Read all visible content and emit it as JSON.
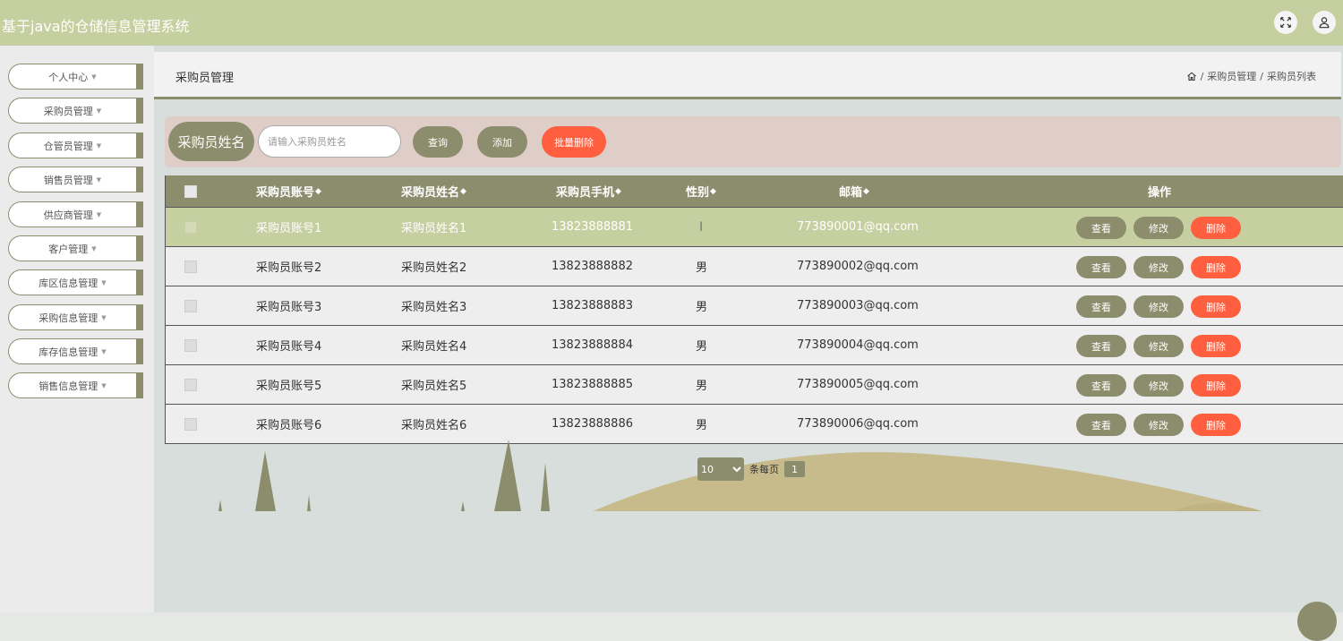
{
  "app": {
    "title": "基于java的仓储信息管理系统"
  },
  "topbar_icons": [
    "fullscreen-icon",
    "user-icon"
  ],
  "sidebar": {
    "items": [
      {
        "label": "个人中心"
      },
      {
        "label": "采购员管理"
      },
      {
        "label": "仓管员管理"
      },
      {
        "label": "销售员管理"
      },
      {
        "label": "供应商管理"
      },
      {
        "label": "客户管理"
      },
      {
        "label": "库区信息管理"
      },
      {
        "label": "采购信息管理"
      },
      {
        "label": "库存信息管理"
      },
      {
        "label": "销售信息管理"
      }
    ]
  },
  "page": {
    "title": "采购员管理",
    "breadcrumb": {
      "sep": "/",
      "level1": "采购员管理",
      "level2": "采购员列表"
    }
  },
  "search": {
    "label": "采购员姓名",
    "placeholder": "请输入采购员姓名",
    "value": "",
    "query_button": "查询",
    "add_button": "添加",
    "batch_delete_button": "批量删除"
  },
  "table": {
    "headers": {
      "account": "采购员账号",
      "name": "采购员姓名",
      "phone": "采购员手机",
      "gender": "性别",
      "email": "邮箱",
      "actions": "操作"
    },
    "sort_glyph": "◆",
    "action_labels": {
      "view": "查看",
      "edit": "修改",
      "delete": "删除"
    },
    "rows": [
      {
        "account": "采购员账号1",
        "name": "采购员姓名1",
        "phone": "13823888881",
        "gender": "",
        "email": "773890001@qq.com"
      },
      {
        "account": "采购员账号2",
        "name": "采购员姓名2",
        "phone": "13823888882",
        "gender": "男",
        "email": "773890002@qq.com"
      },
      {
        "account": "采购员账号3",
        "name": "采购员姓名3",
        "phone": "13823888883",
        "gender": "男",
        "email": "773890003@qq.com"
      },
      {
        "account": "采购员账号4",
        "name": "采购员姓名4",
        "phone": "13823888884",
        "gender": "男",
        "email": "773890004@qq.com"
      },
      {
        "account": "采购员账号5",
        "name": "采购员姓名5",
        "phone": "13823888885",
        "gender": "男",
        "email": "773890005@qq.com"
      },
      {
        "account": "采购员账号6",
        "name": "采购员姓名6",
        "phone": "13823888886",
        "gender": "男",
        "email": "773890006@qq.com"
      }
    ]
  },
  "pagination": {
    "page_size": "10",
    "page_size_label": "条每页",
    "current_page": "1"
  },
  "colors": {
    "accent": "#8c8d6c",
    "topbar": "#c6cf9f",
    "danger": "#ff5f3f",
    "selected_row": "#c6cf9f",
    "search_bg": "#dfcdc8"
  }
}
